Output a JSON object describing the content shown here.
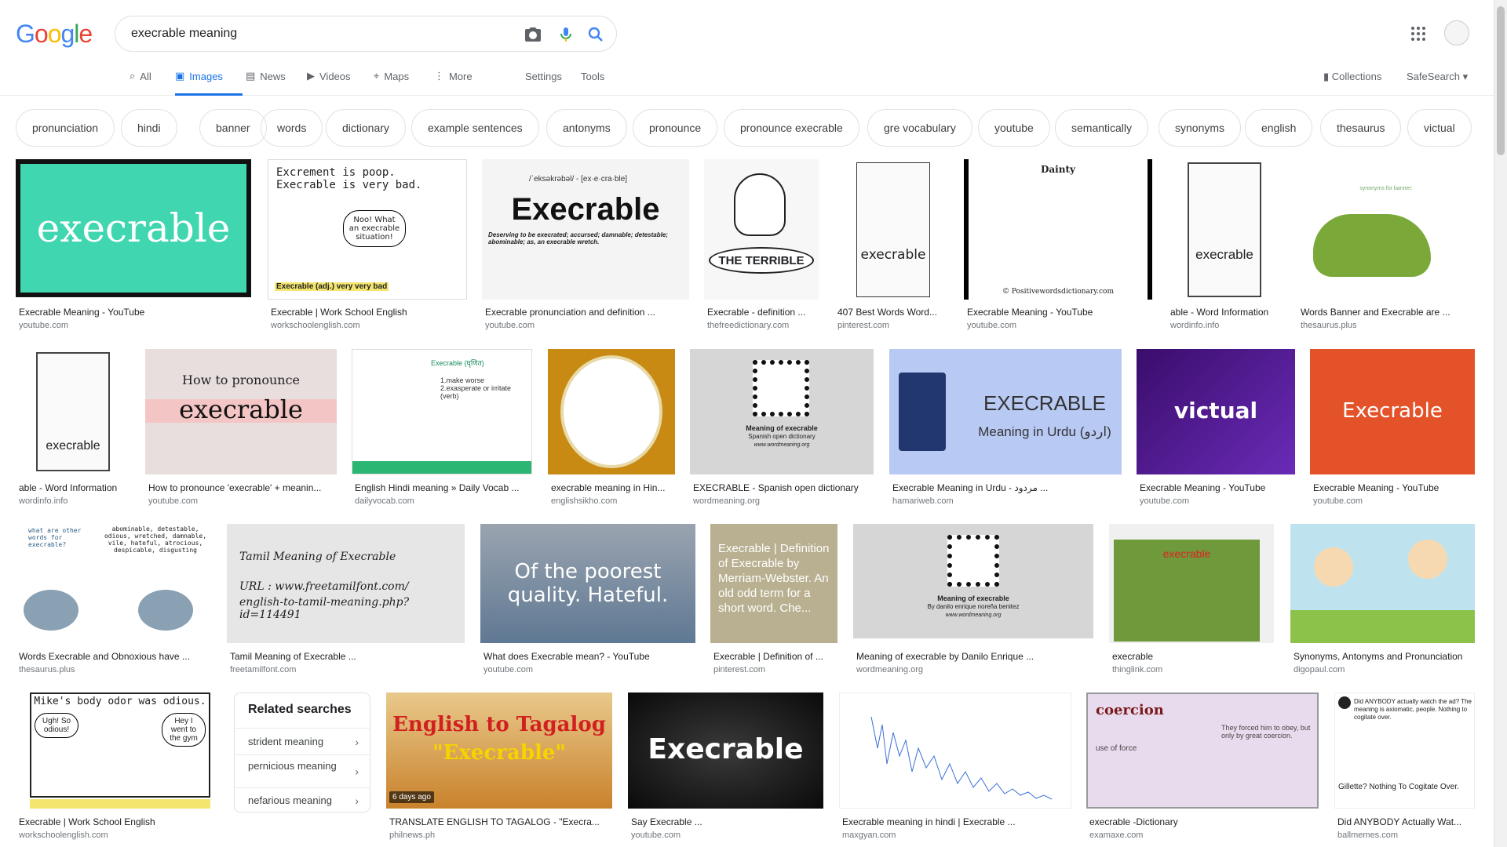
{
  "logo": "Google",
  "search": {
    "query": "execrable meaning"
  },
  "tabs": [
    {
      "label": "All",
      "icon": "search-icon"
    },
    {
      "label": "Images",
      "icon": "image-icon"
    },
    {
      "label": "News",
      "icon": "news-icon"
    },
    {
      "label": "Videos",
      "icon": "video-icon"
    },
    {
      "label": "Maps",
      "icon": "map-icon"
    },
    {
      "label": "More",
      "icon": "more-icon"
    }
  ],
  "tools": {
    "settings": "Settings",
    "tools": "Tools"
  },
  "right": {
    "collections": "Collections",
    "safesearch": "SafeSearch"
  },
  "chips": [
    "pronunciation",
    "hindi",
    "banner",
    "words",
    "dictionary",
    "example sentences",
    "antonyms",
    "pronounce",
    "pronounce execrable",
    "gre vocabulary",
    "youtube",
    "semantically",
    "synonyms",
    "english",
    "thesaurus",
    "victual"
  ],
  "results": [
    {
      "title": "Execrable Meaning - YouTube",
      "source": "youtube.com",
      "caption": "execrable"
    },
    {
      "title": "Execrable | Work School English",
      "source": "workschoolenglish.com",
      "caption": "Excrement is poop. Execrable is very bad.",
      "caption2": "Noo! What an execrable situation!",
      "caption3": "Execrable (adj.) very very bad"
    },
    {
      "title": "Execrable pronunciation and definition ...",
      "source": "youtube.com",
      "caption": "Execrable",
      "caption2": "/ˈeksəkrəbəl/ - [ex·e·cra·ble]",
      "caption3": "Deserving to be execrated; accursed; damnable; detestable; abominable; as, an execrable wretch."
    },
    {
      "title": "Execrable - definition ...",
      "source": "thefreedictionary.com",
      "caption": "THE TERRIBLE"
    },
    {
      "title": "407 Best Words Word...",
      "source": "pinterest.com",
      "caption": "execrable"
    },
    {
      "title": "Execrable Meaning - YouTube",
      "source": "youtube.com",
      "caption": "Dainty",
      "caption2": "© Positivewordsdictionary.com"
    },
    {
      "title": "able - Word Information",
      "source": "wordinfo.info",
      "caption": "execrable"
    },
    {
      "title": "Words Banner and Execrable are ...",
      "source": "thesaurus.plus",
      "caption": "synonyms for banner:"
    },
    {
      "title": "able - Word Information",
      "source": "wordinfo.info",
      "caption": "execrable"
    },
    {
      "title": "How to pronounce 'execrable' + meanin...",
      "source": "youtube.com",
      "caption": "How to pronounce",
      "caption2": "execrable"
    },
    {
      "title": "English Hindi meaning » Daily Vocab ...",
      "source": "dailyvocab.com",
      "caption": "Execrable (घृणित)",
      "caption2": "1.make worse 2.exasperate or irritate (verb)"
    },
    {
      "title": "execrable meaning in Hin...",
      "source": "englishsikho.com"
    },
    {
      "title": "EXECRABLE - Spanish open dictionary",
      "source": "wordmeaning.org",
      "caption": "Meaning of execrable",
      "caption2": "Spanish open dictionary",
      "caption3": "www.wordmeaning.org"
    },
    {
      "title": "Execrable Meaning in Urdu - مردود ...",
      "source": "hamariweb.com",
      "caption": "EXECRABLE",
      "caption2": "Meaning in Urdu (اردو)"
    },
    {
      "title": "Execrable Meaning - YouTube",
      "source": "youtube.com",
      "caption": "victual"
    },
    {
      "title": "Execrable Meaning - YouTube",
      "source": "youtube.com",
      "caption": "Execrable"
    },
    {
      "title": "Words Execrable and Obnoxious have ...",
      "source": "thesaurus.plus",
      "caption": "what are other words for execrable?",
      "caption2": "abominable, detestable, odious, wretched, damnable, vile, hateful, atrocious, despicable, disgusting"
    },
    {
      "title": "Tamil Meaning of Execrable ...",
      "source": "freetamilfont.com",
      "caption": "Tamil Meaning of Execrable",
      "caption2": "URL : www.freetamilfont.com/",
      "caption3": "english-to-tamil-meaning.php?id=114491"
    },
    {
      "title": "What does Execrable mean? - YouTube",
      "source": "youtube.com",
      "caption": "Of the poorest quality. Hateful."
    },
    {
      "title": "Execrable | Definition of ...",
      "source": "pinterest.com",
      "caption": "Execrable | Definition of Execrable by Merriam-Webster. An old odd term for a short word. Che..."
    },
    {
      "title": "Meaning of execrable by Danilo Enrique ...",
      "source": "wordmeaning.org",
      "caption": "Meaning of execrable",
      "caption2": "By danilo enrique noreña benitez",
      "caption3": "www.wordmeaning.org"
    },
    {
      "title": "execrable",
      "source": "thinglink.com",
      "caption": "execrable"
    },
    {
      "title": "Synonyms, Antonyms and Pronunciation",
      "source": "digopaul.com"
    },
    {
      "title": "Execrable | Work School English",
      "source": "workschoolenglish.com",
      "caption": "Mike's body odor was odious.",
      "caption2": "Ugh! So odious!",
      "caption3": "Hey I went to the gym"
    },
    {
      "title": "TRANSLATE ENGLISH TO TAGALOG - \"Execra...",
      "source": "philnews.ph",
      "caption": "English to Tagalog",
      "caption2": "\"Execrable\"",
      "caption3": "6 days ago"
    },
    {
      "title": "Say Execrable ...",
      "source": "youtube.com",
      "caption": "Execrable"
    },
    {
      "title": "Execrable meaning in hindi | Execrable ...",
      "source": "maxgyan.com"
    },
    {
      "title": "execrable -Dictionary",
      "source": "examaxe.com",
      "caption": "coercion",
      "caption2": "They forced him to obey, but only by great coercion.",
      "caption3": "use of force"
    },
    {
      "title": "Did ANYBODY Actually Wat...",
      "source": "ballmemes.com",
      "caption": "Did ANYBODY actually watch the ad? The meaning is axiomatic, people. Nothing to cogitate over.",
      "caption2": "Gillette? Nothing To Cogitate Over."
    }
  ],
  "related": {
    "heading": "Related searches",
    "items": [
      "strident meaning",
      "pernicious meaning",
      "nefarious meaning"
    ]
  }
}
